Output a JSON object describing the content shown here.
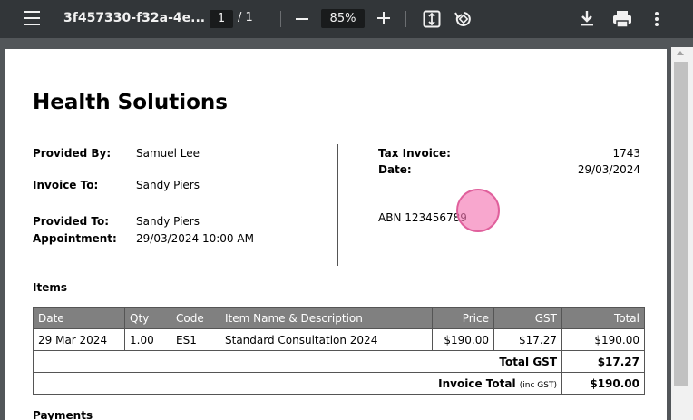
{
  "toolbar": {
    "title": "3f457330-f32a-4e...",
    "page_current": "1",
    "page_total": "/ 1",
    "zoom": "85%"
  },
  "invoice": {
    "company": "Health Solutions",
    "provided_by_label": "Provided By:",
    "provided_by": "Samuel Lee",
    "invoice_to_label": "Invoice To:",
    "invoice_to": "Sandy Piers",
    "provided_to_label": "Provided To:",
    "provided_to": "Sandy Piers",
    "appointment_label": "Appointment:",
    "appointment": "29/03/2024 10:00 AM",
    "tax_invoice_label": "Tax Invoice:",
    "tax_invoice": "1743",
    "date_label": "Date:",
    "date": "29/03/2024",
    "abn": "ABN 123456789",
    "items_heading": "Items",
    "payments_heading": "Payments"
  },
  "table": {
    "headers": [
      "Date",
      "Qty",
      "Code",
      "Item Name & Description",
      "Price",
      "GST",
      "Total"
    ],
    "rows": [
      [
        "29 Mar 2024",
        "1.00",
        "ES1",
        "Standard Consultation 2024",
        "$190.00",
        "$17.27",
        "$190.00"
      ]
    ],
    "total_gst_label": "Total GST",
    "total_gst": "$17.27",
    "invoice_total_label": "Invoice Total",
    "invoice_total_note": "(inc GST)",
    "invoice_total": "$190.00"
  },
  "colors": {
    "toolbar_bg": "#323639",
    "viewer_bg": "#525659",
    "table_header_bg": "#808080"
  }
}
